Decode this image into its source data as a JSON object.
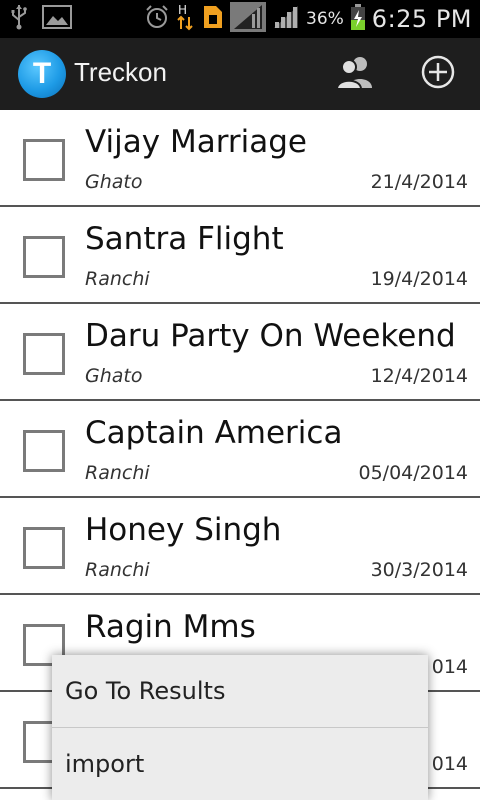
{
  "status_bar": {
    "time": "6:25 PM",
    "battery_percent": "36%",
    "network_type": "H",
    "icons": [
      "usb-icon",
      "gallery-icon",
      "alarm-icon",
      "data-arrows-icon",
      "sim-icon",
      "signal-icon",
      "battery-charging-icon"
    ]
  },
  "action_bar": {
    "logo_letter": "T",
    "title": "Treckon",
    "actions": [
      "contacts-icon",
      "add-circle-icon"
    ]
  },
  "tasks": [
    {
      "title": "Vijay Marriage",
      "location": "Ghato",
      "date": "21/4/2014",
      "checked": false
    },
    {
      "title": "Santra Flight",
      "location": "Ranchi",
      "date": "19/4/2014",
      "checked": false
    },
    {
      "title": "Daru Party On Weekend",
      "location": "Ghato",
      "date": "12/4/2014",
      "checked": false
    },
    {
      "title": "Captain America",
      "location": "Ranchi",
      "date": "05/04/2014",
      "checked": false
    },
    {
      "title": "Honey Singh",
      "location": "Ranchi",
      "date": "30/3/2014",
      "checked": false
    },
    {
      "title": "Ragin Mms",
      "location": "",
      "date": "014",
      "checked": false
    },
    {
      "title": "",
      "location": "",
      "date": "014",
      "checked": false
    }
  ],
  "popup_menu": {
    "items": [
      "Go To Results",
      "import"
    ]
  },
  "colors": {
    "status_bar_bg": "#000000",
    "action_bar_bg": "#1e1e1e",
    "logo_blue": "#1e9be6",
    "list_bg": "#ffffff",
    "menu_bg": "#ececec",
    "battery_green": "#7ad02c"
  }
}
